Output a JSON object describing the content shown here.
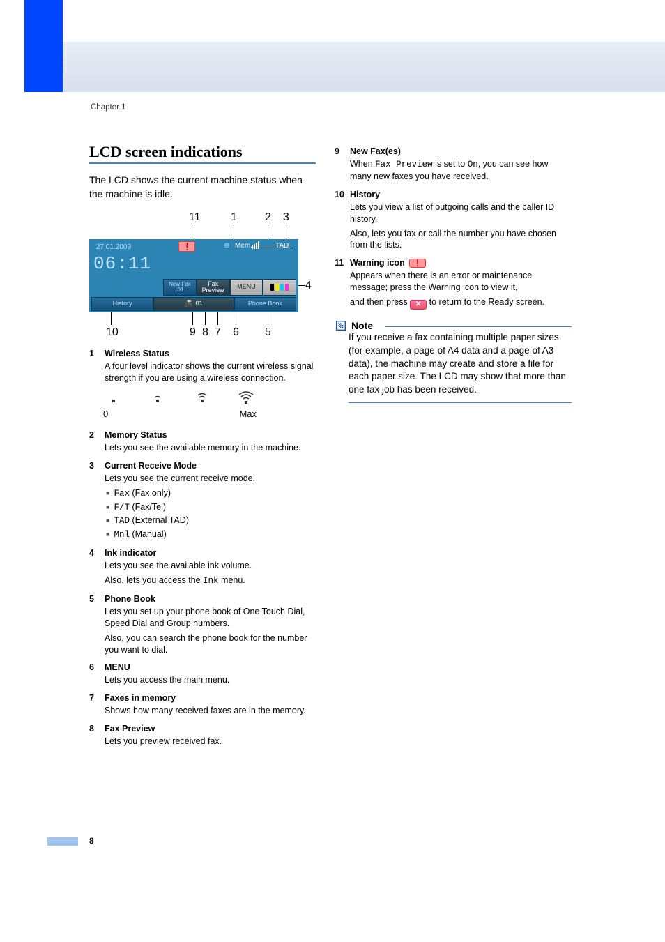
{
  "chapter": "Chapter 1",
  "section_title": "LCD screen indications",
  "intro": "The LCD shows the current machine status when the machine is idle.",
  "lcd": {
    "date": "27.01.2009",
    "time": "06:11",
    "mem_label": "Mem.",
    "tad_label": "TAD",
    "new_fax_label": "New Fax",
    "new_fax_count": ":01",
    "fax_preview_label": "Fax Preview",
    "menu_label": "MENU",
    "fax_mem_count": "01",
    "history_label": "History",
    "phone_book_label": "Phone Book"
  },
  "callouts": {
    "1": "1",
    "2": "2",
    "3": "3",
    "4": "4",
    "5": "5",
    "6": "6",
    "7": "7",
    "8": "8",
    "9": "9",
    "10": "10",
    "11": "11"
  },
  "wifi_scale": {
    "min": "0",
    "max": "Max"
  },
  "defs": [
    {
      "num": "1",
      "title": "Wireless Status",
      "body": [
        "A four level indicator shows the current wireless signal strength if you are using a wireless connection."
      ]
    },
    {
      "num": "2",
      "title": "Memory Status",
      "body": [
        "Lets you see the available memory in the machine."
      ]
    },
    {
      "num": "3",
      "title": "Current Receive Mode",
      "body": [
        "Lets you see the current receive mode."
      ],
      "bullets": [
        {
          "code": "Fax",
          "text": " (Fax only)"
        },
        {
          "code": "F/T",
          "text": " (Fax/Tel)"
        },
        {
          "code": "TAD",
          "text": " (External TAD)"
        },
        {
          "code": "Mnl",
          "text": " (Manual)"
        }
      ]
    },
    {
      "num": "4",
      "title": "Ink indicator",
      "body_parts": {
        "a": "Lets you see the available ink volume.",
        "b_pre": "Also, lets you access the ",
        "b_code": "Ink",
        "b_post": " menu."
      }
    },
    {
      "num": "5",
      "title": "Phone Book",
      "body": [
        "Lets you set up your phone book of One Touch Dial, Speed Dial and Group numbers.",
        "Also, you can search the phone book for the number you want to dial."
      ]
    },
    {
      "num": "6",
      "title": "MENU",
      "body": [
        "Lets you access the main menu."
      ]
    },
    {
      "num": "7",
      "title": "Faxes in memory",
      "body": [
        "Shows how many received faxes are in the memory."
      ]
    },
    {
      "num": "8",
      "title": "Fax Preview",
      "body": [
        "Lets you preview received fax."
      ]
    }
  ],
  "defs_right": [
    {
      "num": "9",
      "title": "New Fax(es)",
      "body_parts": {
        "pre": "When ",
        "code1": "Fax Preview",
        "mid": " is set to ",
        "code2": "On",
        "post": ", you can see how many new faxes you have received."
      }
    },
    {
      "num": "10",
      "title": "History",
      "body": [
        "Lets you view a list of outgoing calls and the caller ID history.",
        "Also, lets you fax or call the number you have chosen from the lists."
      ]
    },
    {
      "num": "11",
      "title": "Warning icon",
      "body_parts": {
        "line1": "Appears when there is an error or maintenance message; press the Warning icon to view it,",
        "line2_pre": "and then press ",
        "line2_post": " to return to the Ready screen."
      }
    }
  ],
  "note": {
    "label": "Note",
    "body": "If you receive a fax containing multiple paper sizes (for example, a page of A4 data and a page of A3 data), the machine may create and store a file for each paper size. The LCD may show that more than one fax job has been received."
  },
  "page_number": "8"
}
